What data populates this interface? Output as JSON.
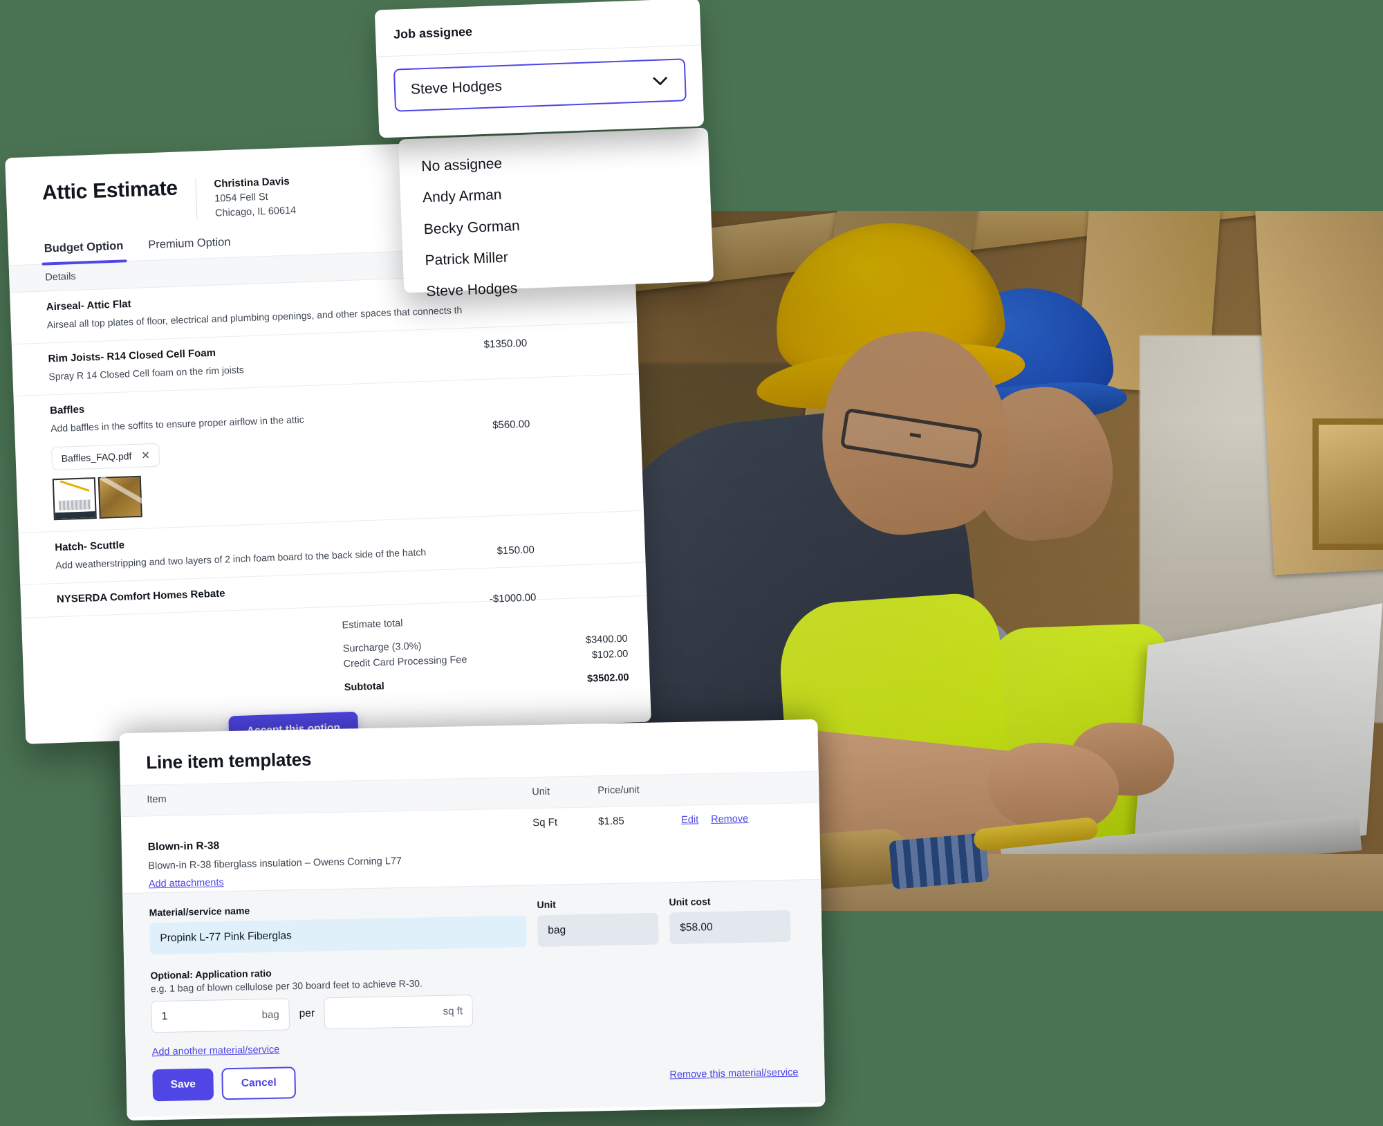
{
  "background_color": "#4A7353",
  "accent_color": "#4F46E5",
  "assignee_panel": {
    "label": "Job assignee",
    "selected": "Steve Hodges",
    "chevron_icon": "chevron-down-icon",
    "options": [
      "No assignee",
      "Andy Arman",
      "Becky Gorman",
      "Patrick Miller",
      "Steve Hodges"
    ]
  },
  "estimate": {
    "title": "Attic Estimate",
    "customer": {
      "name": "Christina Davis",
      "address_line1": "1054 Fell St",
      "address_line2": "Chicago, IL 60614"
    },
    "tabs": [
      {
        "label": "Budget Option",
        "active": true
      },
      {
        "label": "Premium Option",
        "active": false
      }
    ],
    "column_header": "Details",
    "line_items": [
      {
        "title": "Airseal- Attic Flat",
        "description": "Airseal all top plates of floor, electrical and plumbing openings, and other spaces that connects th",
        "amount": ""
      },
      {
        "title": "Rim Joists- R14 Closed Cell Foam",
        "description": "Spray R 14 Closed Cell foam on the rim joists",
        "amount": "$1350.00"
      },
      {
        "title": "Baffles",
        "description": "Add baffles in the soffits to ensure proper airflow in the attic",
        "amount": "$560.00",
        "attachment": {
          "filename": "Baffles_FAQ.pdf",
          "remove_icon": "close-icon"
        },
        "thumbnails": [
          "baffle-diagram-thumbnail",
          "attic-photo-thumbnail"
        ]
      },
      {
        "title": "Hatch- Scuttle",
        "description": "Add weatherstripping and two layers of 2 inch foam board to the back side of the hatch",
        "amount": "$150.00"
      },
      {
        "title": "NYSERDA Comfort Homes Rebate",
        "description": "",
        "amount": "-$1000.00"
      }
    ],
    "totals": [
      {
        "label": "Estimate total",
        "value": "",
        "bold": false,
        "gap": false
      },
      {
        "label": "Surcharge (3.0%)",
        "value": "$3400.00",
        "bold": false,
        "gap": false
      },
      {
        "label": "Credit Card Processing Fee",
        "value": "$102.00",
        "bold": false,
        "gap": false
      },
      {
        "label": "Subtotal",
        "value": "$3502.00",
        "bold": true,
        "gap": true
      }
    ],
    "accept_button": "Accept this option"
  },
  "templates": {
    "title": "Line item templates",
    "columns": {
      "item": "Item",
      "unit": "Unit",
      "price": "Price/unit"
    },
    "row": {
      "name": "Blown-in R-38",
      "description": "Blown-in R-38 fiberglass insulation – Owens Corning L77",
      "unit": "Sq Ft",
      "price": "$1.85",
      "edit_label": "Edit",
      "remove_label": "Remove",
      "add_attachments_label": "Add attachments"
    },
    "form": {
      "material_name_label": "Material/service name",
      "material_name_value": "Propink L-77 Pink Fiberglas",
      "unit_label": "Unit",
      "unit_value": "bag",
      "unit_cost_label": "Unit cost",
      "unit_cost_value": "$58.00",
      "ratio_label": "Optional: Application ratio",
      "ratio_hint": "e.g. 1 bag of blown cellulose per 30 board feet to achieve R-30.",
      "ratio_qty_value": "1",
      "ratio_qty_suffix": "bag",
      "ratio_per_label": "per",
      "ratio_area_value": "",
      "ratio_area_suffix": "sq ft",
      "remove_material_label": "Remove this material/service",
      "add_another_label": "Add another material/service",
      "save_label": "Save",
      "cancel_label": "Cancel"
    }
  },
  "photo": {
    "alt": "two-construction-workers-with-hard-hats-looking-at-laptop"
  }
}
